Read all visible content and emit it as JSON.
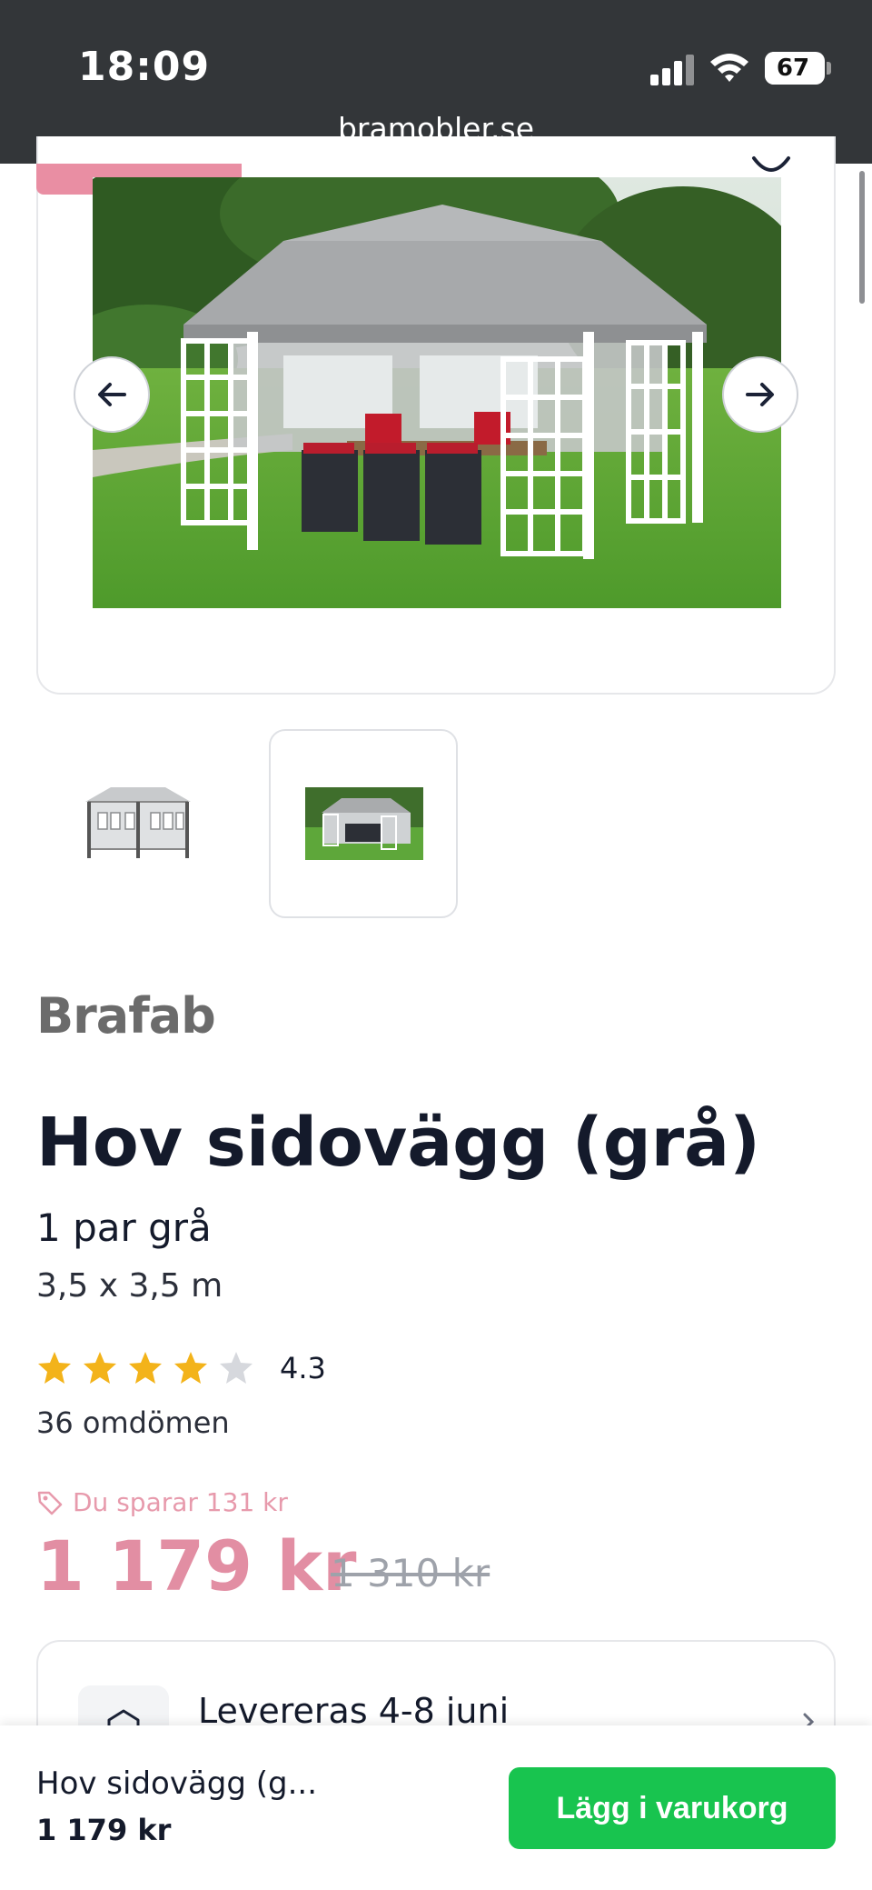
{
  "status_bar": {
    "time": "18:09",
    "battery": "67",
    "battery_level": 0.67
  },
  "browser": {
    "url": "bramobler.se"
  },
  "gallery": {
    "main_image_alt": "Hov paviljong med sidoväggar",
    "prev_icon": "arrow-left-icon",
    "next_icon": "arrow-right-icon",
    "thumbnails": [
      {
        "name": "thumbnail-1",
        "selected": false
      },
      {
        "name": "thumbnail-2",
        "selected": true
      }
    ]
  },
  "product": {
    "brand": "Brafab",
    "title": "Hov sidovägg (grå)",
    "variant": "1 par grå",
    "size": "3,5 x 3,5 m",
    "rating": "4.3",
    "rating_value": 4.3,
    "stars_max": 5,
    "reviews": "36 omdömen",
    "savings": "Du sparar 131 kr",
    "price": "1 179 kr",
    "old_price": "1 310 kr"
  },
  "delivery": {
    "text": "Levereras 4-8 juni"
  },
  "sticky_bar": {
    "name": "Hov sidovägg (g...",
    "price": "1 179 kr",
    "cart_button": "Lägg i varukorg"
  },
  "colors": {
    "accent_green": "#18c44f",
    "sale_pink": "#e28ea3",
    "star_gold": "#f3b31a",
    "dark_bar": "#333639"
  }
}
